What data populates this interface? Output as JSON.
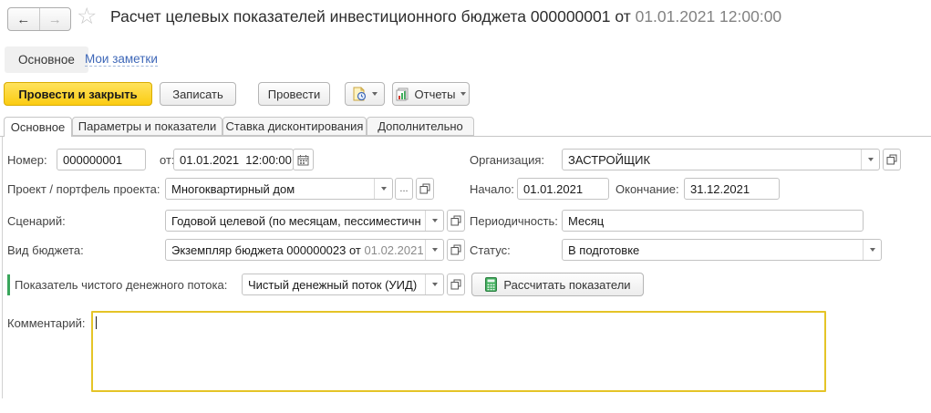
{
  "colors": {
    "accent_yellow": "#fbcc12",
    "comment_highlight_border": "#e5c427",
    "link_blue": "#3f68b8",
    "required_marker_green": "#3aa65c"
  },
  "header": {
    "title": "Расчет целевых показателей инвестиционного бюджета 000000001 от",
    "title_datetime": "01.01.2021 12:00:00"
  },
  "nav": {
    "main_tab": "Основное",
    "notes_link": "Мои заметки"
  },
  "toolbar": {
    "post_and_close": "Провести и закрыть",
    "save": "Записать",
    "post": "Провести",
    "reports": "Отчеты"
  },
  "tabs": {
    "main": "Основное",
    "params": "Параметры и показатели",
    "discount": "Ставка дисконтирования",
    "additional": "Дополнительно"
  },
  "form": {
    "number_label": "Номер:",
    "number_value": "000000001",
    "date_label": "от:",
    "date_value": "01.01.2021  12:00:00",
    "organization_label": "Организация:",
    "organization_value": "ЗАСТРОЙЩИК",
    "project_label": "Проект / портфель проекта:",
    "project_value": "Многоквартирный дом",
    "ellipsis": "...",
    "start_label": "Начало:",
    "start_value": "01.01.2021",
    "end_label": "Окончание:",
    "end_value": "31.12.2021",
    "scenario_label": "Сценарий:",
    "scenario_value": "Годовой целевой (по месяцам, пессиместичн",
    "periodicity_label": "Периодичность:",
    "periodicity_value": "Месяц",
    "budget_kind_label": "Вид бюджета:",
    "budget_kind_value": "Экземпляр бюджета 000000023 от",
    "budget_kind_date": " 01.02.2021",
    "status_label": "Статус:",
    "status_value": "В подготовке",
    "cashflow_label": "Показатель чистого денежного потока:",
    "cashflow_value": "Чистый денежный поток (УИД)",
    "calculate_button": "Рассчитать показатели",
    "comment_label": "Комментарий:"
  },
  "icons": {
    "back": "arrow-left",
    "forward": "arrow-right",
    "favorite": "star-outline",
    "create_based_on": "document-clock",
    "reports": "report-chart",
    "calendar": "calendar",
    "open": "open-in-window",
    "calculator": "calculator"
  }
}
